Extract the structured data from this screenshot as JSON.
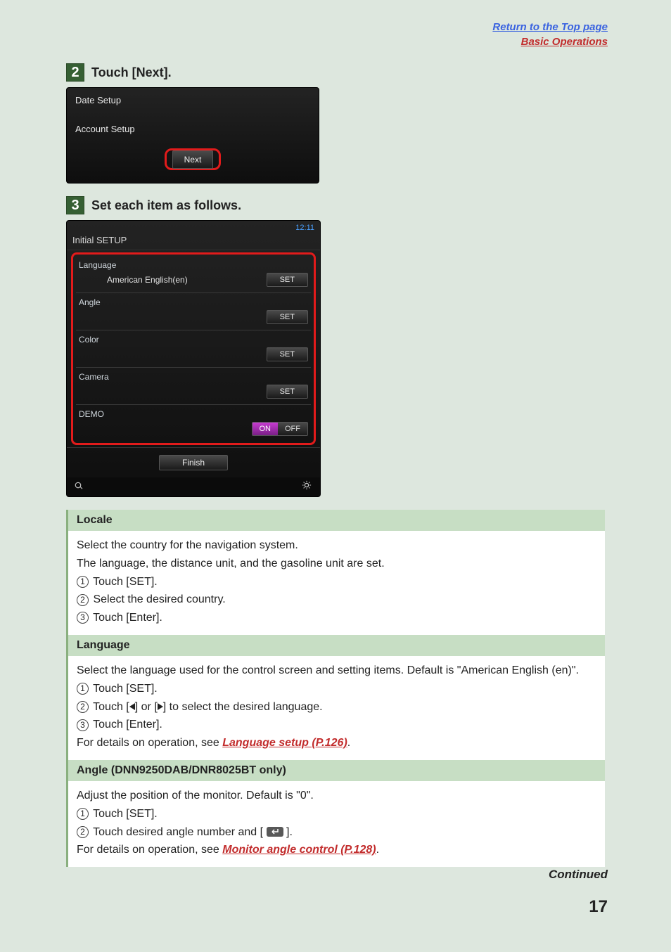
{
  "header": {
    "return_link": "Return to the Top page",
    "basic_ops_link": "Basic Operations"
  },
  "step2": {
    "number": "2",
    "text": "Touch [Next].",
    "shot": {
      "line1": "Date Setup",
      "line2": "Account Setup",
      "next": "Next"
    }
  },
  "step3": {
    "number": "3",
    "text": "Set each item as follows.",
    "shot": {
      "clock": "12:11",
      "title": "Initial SETUP",
      "items": [
        {
          "label": "Language",
          "value": "American English(en)",
          "btn": "SET"
        },
        {
          "label": "Angle",
          "value": "",
          "btn": "SET"
        },
        {
          "label": "Color",
          "value": "",
          "btn": "SET"
        },
        {
          "label": "Camera",
          "value": "",
          "btn": "SET"
        }
      ],
      "demo_label": "DEMO",
      "on": "ON",
      "off": "OFF",
      "finish": "Finish"
    }
  },
  "sections": {
    "locale": {
      "title": "Locale",
      "l1": "Select the country for the navigation system.",
      "l2": "The language, the distance unit, and the gasoline unit are set.",
      "s1": "Touch [SET].",
      "s2": "Select the desired country.",
      "s3": "Touch [Enter]."
    },
    "language": {
      "title": "Language",
      "l1": "Select the language used for the control screen and setting items. Default is \"American English (en)\".",
      "s1": "Touch [SET].",
      "s2a": "Touch [",
      "s2b": "] or [",
      "s2c": "] to select the desired language.",
      "s3": "Touch [Enter].",
      "det_prefix": "For details on operation, see ",
      "det_link": "Language setup (P.126)",
      "det_suffix": "."
    },
    "angle": {
      "title": "Angle (DNN9250DAB/DNR8025BT only)",
      "l1": "Adjust the position of the monitor. Default is \"0\".",
      "s1": "Touch [SET].",
      "s2a": "Touch desired angle number and [",
      "s2b": "].",
      "det_prefix": "For details on operation, see ",
      "det_link": "Monitor angle control (P.128)",
      "det_suffix": "."
    }
  },
  "footer": {
    "continued": "Continued",
    "page": "17"
  }
}
